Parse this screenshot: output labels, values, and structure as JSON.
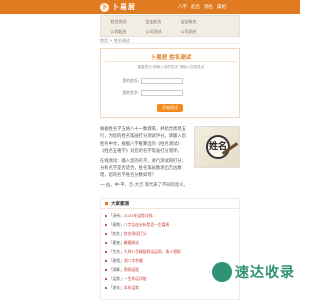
{
  "header": {
    "logo_mark": "卜",
    "logo_text": "卜易居",
    "nav": [
      "八字",
      "起名",
      "测名",
      "属相"
    ]
  },
  "subnav": [
    "姓名测试",
    "宝宝起名",
    "宝宝取名",
    "公司起名",
    "公司测试",
    "公司测名"
  ],
  "breadcrumb": {
    "home": "首页",
    "sep": " > ",
    "current": "姓名测试"
  },
  "form": {
    "title": "卜易居 姓名测试",
    "hint": "重要提示:请输入您的姓名 请输入您的姓名",
    "surname_label": "您的姓氏:",
    "name_label": "您的名字:",
    "submit_label": "开始测试"
  },
  "article": {
    "p1": "根据姓名学五格八十一数理来，并结合周易五行，为您的姓名笔画打分测试评分。请输入您姓名中文，根据八字推算出的《姓名测试》《姓名五格学》对您的名字笔画打分测评。",
    "p2": "在线测试：输入您的名字，进行测试和打分，分析名字是否适合，姓名笔画数测出吉凶数理，您的名字姓名分数如何？",
    "p3": "一-凶，中-平，吉-大吉 等代表了不同的含义。"
  },
  "image": {
    "seal_text": "姓名"
  },
  "list": {
    "title": "大家都测",
    "items": [
      {
        "tag": "「汤伟」",
        "text": "2023年运势详批:"
      },
      {
        "tag": "「星期」",
        "text": "八字吉凶分析是否一生富贵"
      },
      {
        "tag": "「姓名」",
        "text": "姓名测试打分"
      },
      {
        "tag": "「星座」",
        "text": "婚姻测试"
      },
      {
        "tag": "「生肖」",
        "text": "大师八字精批财运运势，贵人相助"
      },
      {
        "tag": "「星相」",
        "text": "测八字合婚"
      },
      {
        "tag": "「测算」",
        "text": "预测运程"
      },
      {
        "tag": "「运势」",
        "text": "一生命运详批"
      },
      {
        "tag": "「流年」",
        "text": "本年运势"
      }
    ]
  },
  "watermark": {
    "text": "速达收录"
  }
}
